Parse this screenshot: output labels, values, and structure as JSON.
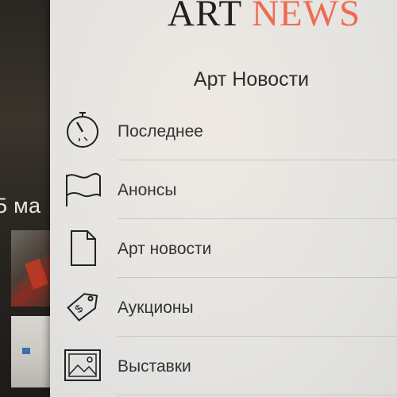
{
  "background": {
    "date_fragment": "5 ма"
  },
  "logo": {
    "word1": "ART",
    "word2": "NEWS",
    "accent_color": "#f06a4e"
  },
  "menu": {
    "title": "Арт Новости",
    "items": [
      {
        "label": "Последнее",
        "icon": "stopwatch-icon"
      },
      {
        "label": "Анонсы",
        "icon": "flag-icon"
      },
      {
        "label": "Арт новости",
        "icon": "document-icon"
      },
      {
        "label": "Аукционы",
        "icon": "price-tag-icon"
      },
      {
        "label": "Выставки",
        "icon": "picture-icon"
      }
    ]
  }
}
